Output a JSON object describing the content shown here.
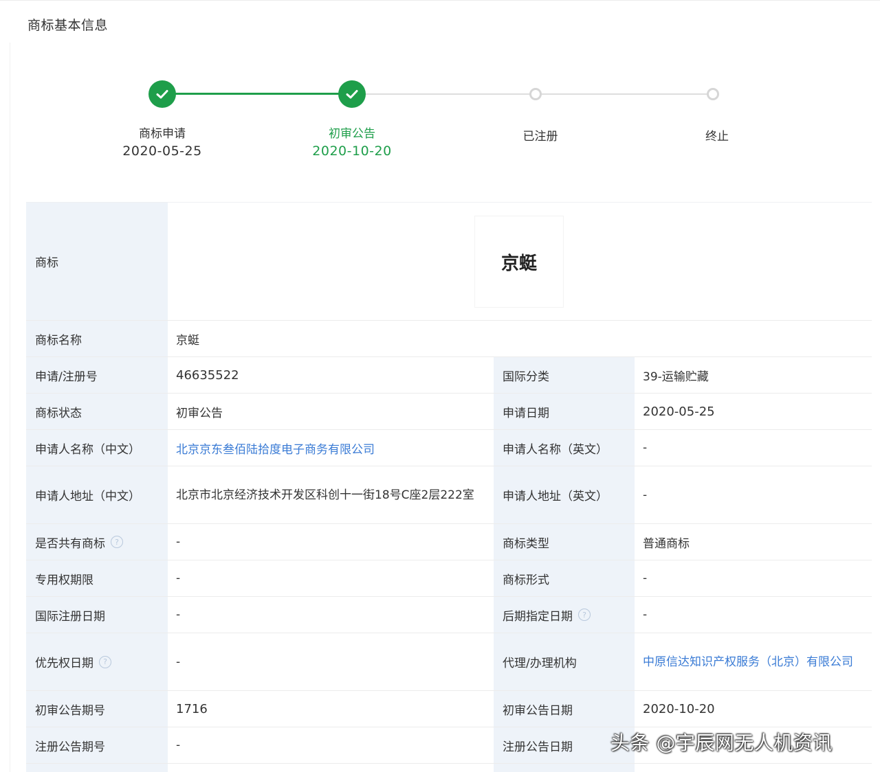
{
  "header": {
    "title": "商标基本信息"
  },
  "steps": [
    {
      "label": "商标申请",
      "date": "2020-05-25",
      "status": "done"
    },
    {
      "label": "初审公告",
      "date": "2020-10-20",
      "status": "active"
    },
    {
      "label": "已注册",
      "date": "",
      "status": "todo"
    },
    {
      "label": "终止",
      "date": "",
      "status": "todo"
    }
  ],
  "trademark": {
    "label": "商标",
    "image_text": "京蜓"
  },
  "rows": {
    "name": {
      "label": "商标名称",
      "value": "京蜓"
    },
    "reg_no": {
      "label": "申请/注册号",
      "value": "46635522",
      "label2": "国际分类",
      "value2": "39-运输贮藏"
    },
    "status": {
      "label": "商标状态",
      "value": "初审公告",
      "label2": "申请日期",
      "value2": "2020-05-25"
    },
    "applicant_name": {
      "label": "申请人名称（中文）",
      "value": "北京京东叁佰陆拾度电子商务有限公司",
      "label2": "申请人名称（英文）",
      "value2": "-"
    },
    "applicant_addr": {
      "label": "申请人地址（中文）",
      "value": "北京市北京经济技术开发区科创十一街18号C座2层222室",
      "label2": "申请人地址（英文）",
      "value2": "-"
    },
    "shared": {
      "label": "是否共有商标",
      "value": "-",
      "label2": "商标类型",
      "value2": "普通商标"
    },
    "exclusive": {
      "label": "专用权期限",
      "value": "-",
      "label2": "商标形式",
      "value2": "-"
    },
    "intl_date": {
      "label": "国际注册日期",
      "value": "-",
      "label2": "后期指定日期",
      "value2": "-"
    },
    "priority": {
      "label": "优先权日期",
      "value": "-",
      "label2": "代理/办理机构",
      "value2": "中原信达知识产权服务（北京）有限公司"
    },
    "prelim_no": {
      "label": "初审公告期号",
      "value": "1716",
      "label2": "初审公告日期",
      "value2": "2020-10-20"
    },
    "reg_pub_no": {
      "label": "注册公告期号",
      "value": "-",
      "label2": "注册公告日期",
      "value2": ""
    }
  },
  "icons": {
    "check": "check-icon",
    "help": "help-circle-icon"
  },
  "colors": {
    "accent": "#1e9e4a",
    "link": "#3a7bd5",
    "label_bg": "#eef3f9"
  },
  "watermark": "头条 @宇辰网无人机资讯"
}
